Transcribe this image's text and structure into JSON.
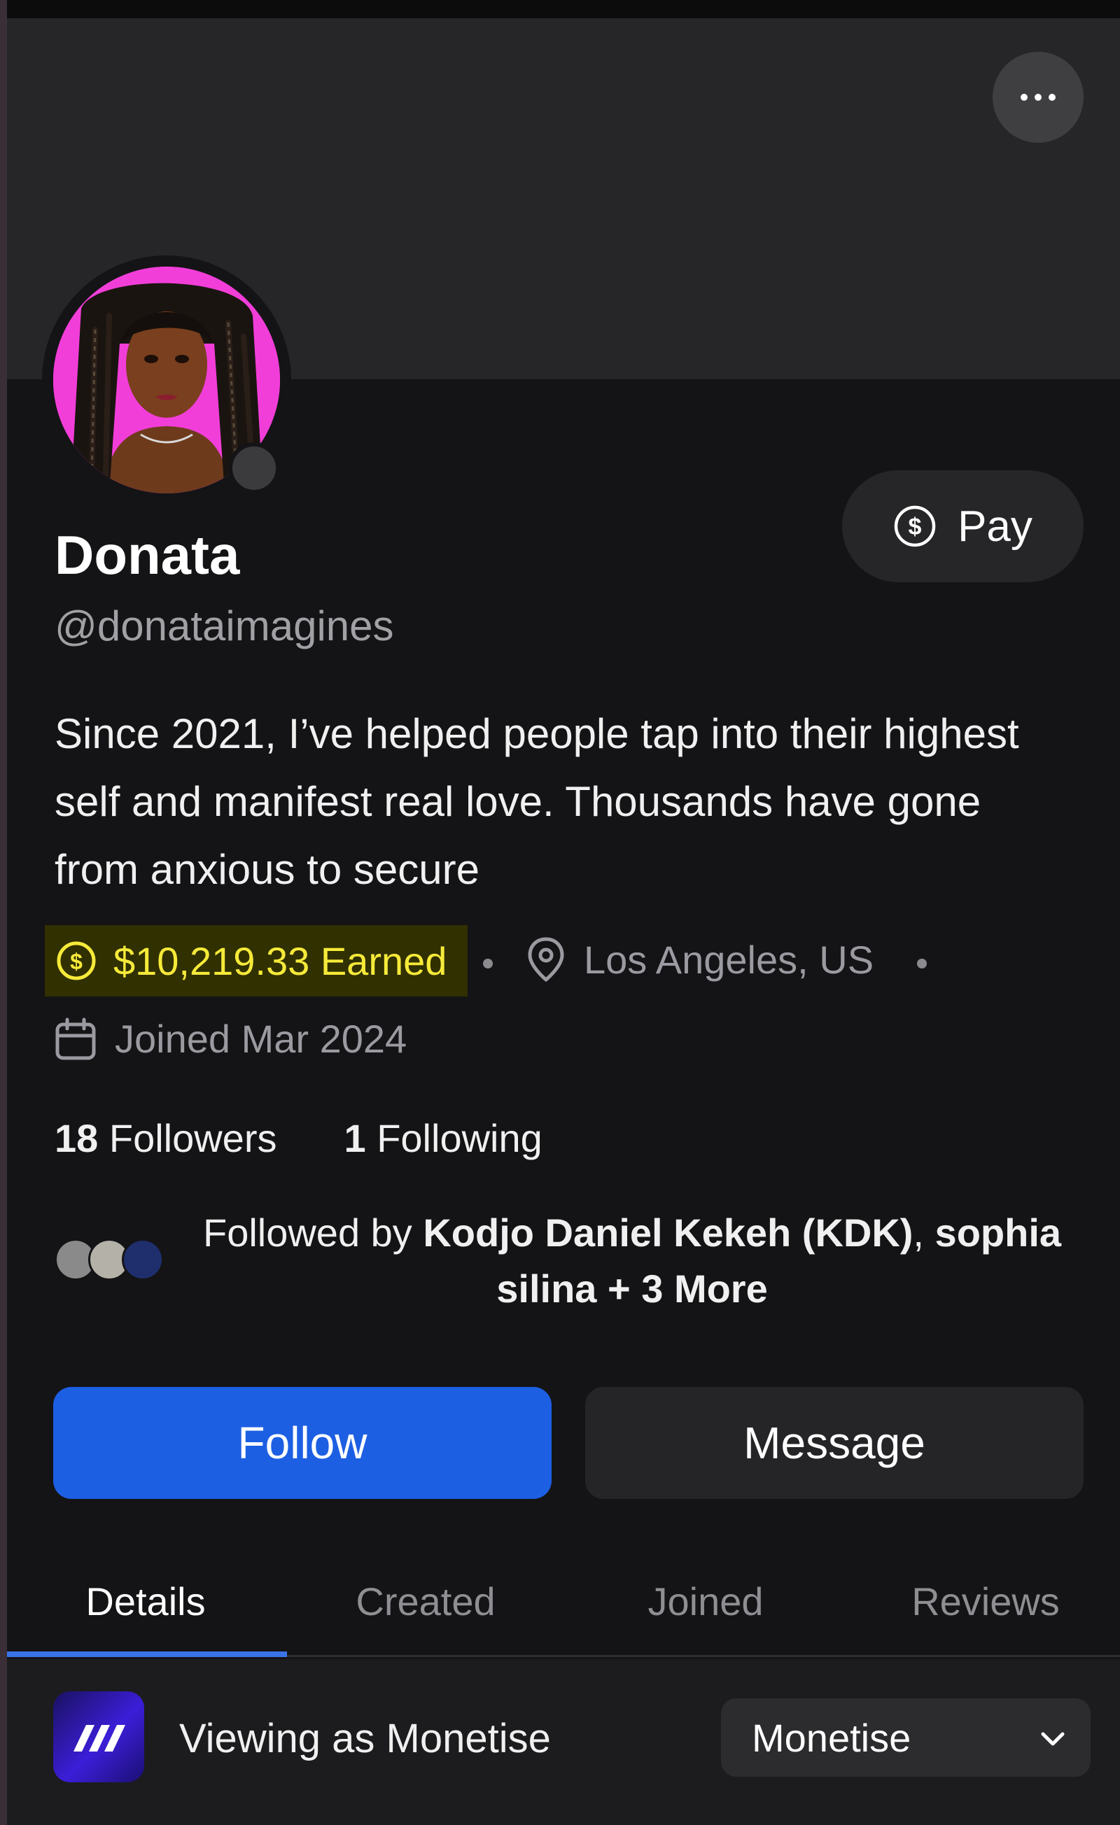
{
  "profile": {
    "name": "Donata",
    "handle": "@donataimagines",
    "bio": "Since 2021, I’ve helped people tap into their highest self and manifest real love. Thousands have gone from anxious to secure",
    "earned": "$10,219.33 Earned",
    "location": "Los Angeles, US",
    "joined": "Joined Mar 2024",
    "followers_count": "18",
    "followers_label": "Followers",
    "following_count": "1",
    "following_label": "Following",
    "followed_by_prefix": "Followed by ",
    "followed_by_name1": "Kodjo Daniel Kekeh (KDK)",
    "followed_by_sep": ", ",
    "followed_by_name2": "sophia silina",
    "followed_by_more": " + 3 More"
  },
  "actions": {
    "pay_label": "Pay",
    "follow_label": "Follow",
    "message_label": "Message"
  },
  "tabs": [
    {
      "label": "Details",
      "active": true
    },
    {
      "label": "Created",
      "active": false
    },
    {
      "label": "Joined",
      "active": false
    },
    {
      "label": "Reviews",
      "active": false
    }
  ],
  "bottom_bar": {
    "viewing_label": "Viewing as Monetise",
    "select_value": "Monetise"
  },
  "icons": {
    "more": "more-horizontal-icon",
    "pay": "dollar-circle-icon",
    "earned": "dollar-circle-icon",
    "location": "map-pin-icon",
    "joined": "calendar-icon",
    "dropdown": "chevron-down-icon"
  },
  "colors": {
    "accent_blue": "#1d5fe3",
    "earned_yellow": "#f6ea3a",
    "earned_bg": "#313000",
    "avatar_bg": "#f23ed9"
  }
}
